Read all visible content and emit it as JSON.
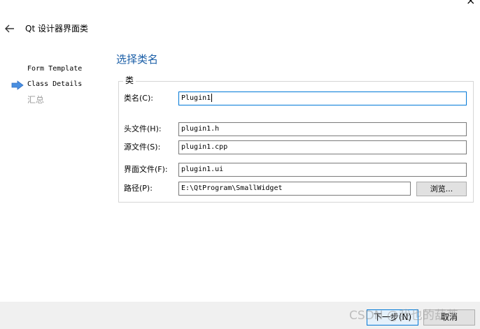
{
  "window": {
    "title": "Qt 设计器界面类",
    "close_glyph": "×"
  },
  "steps": [
    {
      "label": "Form Template"
    },
    {
      "label": "Class Details"
    },
    {
      "label": "汇总"
    }
  ],
  "page": {
    "title": "选择类名",
    "group_title": "类"
  },
  "fields": {
    "class_name": {
      "label": "类名(C):",
      "value": "Plugin1"
    },
    "header_file": {
      "label": "头文件(H):",
      "value": "plugin1.h"
    },
    "source_file": {
      "label": "源文件(S):",
      "value": "plugin1.cpp"
    },
    "form_file": {
      "label": "界面文件(F):",
      "value": "plugin1.ui"
    },
    "path": {
      "label": "路径(P):",
      "value": "E:\\QtProgram\\SmallWidget"
    }
  },
  "buttons": {
    "browse": "浏览...",
    "next": "下一步(N)",
    "cancel": "取消"
  },
  "watermark": "CSDN @我也的葫芦",
  "colors": {
    "accent": "#1a5ea7",
    "focus_border": "#0078d7",
    "current_step_arrow": "#4a8fe0",
    "footer_bg": "#f0f0f0"
  },
  "icons": {
    "back": "arrow-left-icon",
    "current_step": "arrow-right-icon"
  }
}
